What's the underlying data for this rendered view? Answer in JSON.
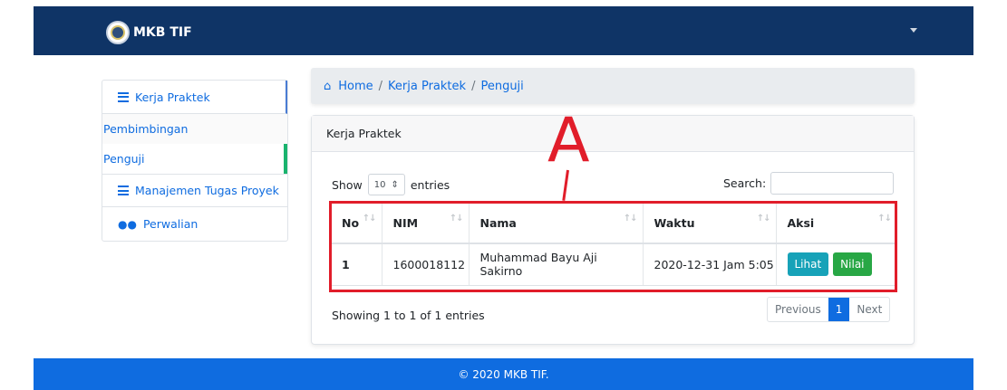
{
  "navbar": {
    "brand": "MKB TIF"
  },
  "sidebar": {
    "items": [
      {
        "label": "Kerja Praktek"
      },
      {
        "label": "Pembimbingan"
      },
      {
        "label": "Penguji"
      },
      {
        "label": "Manajemen Tugas Proyek"
      },
      {
        "label": "Perwalian"
      }
    ]
  },
  "breadcrumb": {
    "home": "Home",
    "sep": "/",
    "level1": "Kerja Praktek",
    "level2": "Penguji"
  },
  "card": {
    "title": "Kerja Praktek",
    "show_label": "Show",
    "entries_value": "10",
    "entries_label": "entries",
    "search_label": "Search:",
    "search_value": "",
    "columns": [
      "No",
      "NIM",
      "Nama",
      "Waktu",
      "Aksi"
    ],
    "rows": [
      {
        "no": "1",
        "nim": "1600018112",
        "nama": "Muhammad Bayu Aji Sakirno",
        "waktu": "2020-12-31 Jam 5:05",
        "btn_lihat": "Lihat",
        "btn_nilai": "Nilai"
      }
    ],
    "info": "Showing 1 to 1 of 1 entries",
    "pagination": {
      "previous": "Previous",
      "page": "1",
      "next": "Next"
    }
  },
  "annotation": {
    "letter": "A"
  },
  "footer": {
    "text": "© 2020 MKB TIF."
  },
  "colors": {
    "navbar": "#0f3466",
    "primary": "#0f6ce0",
    "annotation": "#e11d2a",
    "success": "#28a745",
    "info": "#17a2b8"
  }
}
